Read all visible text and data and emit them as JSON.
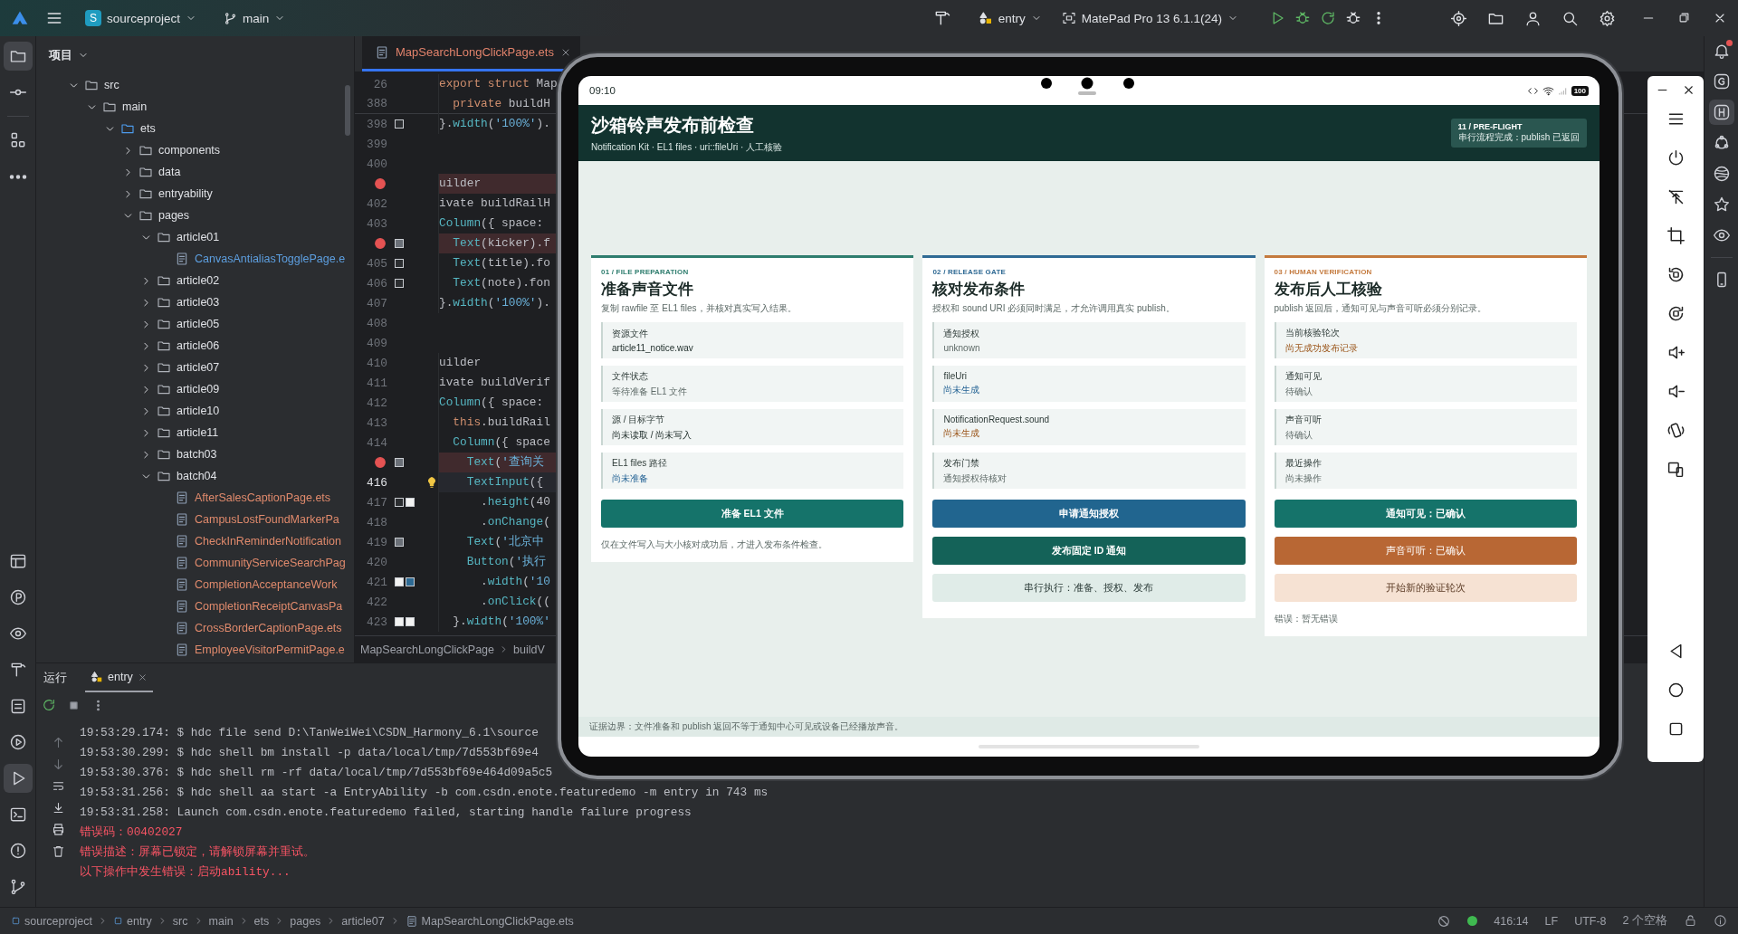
{
  "top_bar": {
    "project_badge": "S",
    "project": "sourceproject",
    "branch": "main",
    "run_config": "entry",
    "device": "MatePad Pro 13 6.1.1(24)"
  },
  "activity_bar": {
    "items": [
      {
        "selected": true
      },
      {
        "selected": false
      },
      {
        "selected": false
      },
      {
        "selected": false
      },
      {
        "selected": false
      },
      {
        "selected": false
      },
      {
        "selected": false
      },
      {
        "selected": false
      },
      {
        "selected": false
      },
      {
        "selected": false
      },
      {
        "selected": true
      },
      {
        "selected": false
      },
      {
        "selected": false
      },
      {
        "selected": false
      }
    ]
  },
  "project_panel": {
    "title": "项目",
    "tree": [
      {
        "name": "src",
        "kind": "folder",
        "expanded": true,
        "children": [
          {
            "name": "main",
            "kind": "folder",
            "expanded": true,
            "children": [
              {
                "name": "ets",
                "kind": "source-folder",
                "expanded": true,
                "children": [
                  {
                    "name": "components",
                    "kind": "folder",
                    "expanded": false
                  },
                  {
                    "name": "data",
                    "kind": "folder",
                    "expanded": false
                  },
                  {
                    "name": "entryability",
                    "kind": "folder",
                    "expanded": false
                  },
                  {
                    "name": "pages",
                    "kind": "folder",
                    "expanded": true,
                    "children": [
                      {
                        "name": "article01",
                        "kind": "folder",
                        "expanded": true,
                        "children": [
                          {
                            "name": "CanvasAntialiasTogglePage.e",
                            "kind": "file",
                            "color": "#5d9fe0"
                          }
                        ]
                      },
                      {
                        "name": "article02",
                        "kind": "folder",
                        "expanded": false
                      },
                      {
                        "name": "article03",
                        "kind": "folder",
                        "expanded": false
                      },
                      {
                        "name": "article05",
                        "kind": "folder",
                        "expanded": false
                      },
                      {
                        "name": "article06",
                        "kind": "folder",
                        "expanded": false
                      },
                      {
                        "name": "article07",
                        "kind": "folder",
                        "expanded": false
                      },
                      {
                        "name": "article09",
                        "kind": "folder",
                        "expanded": false
                      },
                      {
                        "name": "article10",
                        "kind": "folder",
                        "expanded": false
                      },
                      {
                        "name": "article11",
                        "kind": "folder",
                        "expanded": false
                      },
                      {
                        "name": "batch03",
                        "kind": "folder",
                        "expanded": false
                      },
                      {
                        "name": "batch04",
                        "kind": "folder",
                        "expanded": true,
                        "children": [
                          {
                            "name": "AfterSalesCaptionPage.ets",
                            "kind": "file",
                            "color": "#e08a6c"
                          },
                          {
                            "name": "CampusLostFoundMarkerPa",
                            "kind": "file",
                            "color": "#e08a6c"
                          },
                          {
                            "name": "CheckInReminderNotification",
                            "kind": "file",
                            "color": "#e08a6c"
                          },
                          {
                            "name": "CommunityServiceSearchPag",
                            "kind": "file",
                            "color": "#e08a6c"
                          },
                          {
                            "name": "CompletionAcceptanceWork",
                            "kind": "file",
                            "color": "#e08a6c"
                          },
                          {
                            "name": "CompletionReceiptCanvasPa",
                            "kind": "file",
                            "color": "#e08a6c"
                          },
                          {
                            "name": "CrossBorderCaptionPage.ets",
                            "kind": "file",
                            "color": "#e08a6c"
                          },
                          {
                            "name": "EmployeeVisitorPermitPage.e",
                            "kind": "file",
                            "color": "#e08a6c"
                          }
                        ]
                      }
                    ]
                  }
                ]
              }
            ]
          }
        ]
      }
    ]
  },
  "editor": {
    "tab": "MapSearchLongClickPage.ets",
    "lines": [
      {
        "number": "26",
        "text": "export struct Map",
        "kind": "sticky",
        "breakpoint": false,
        "current": false,
        "bulb": false
      },
      {
        "number": "388",
        "text": "  private buildH",
        "kind": "sticky",
        "breakpoint": false,
        "current": false,
        "bulb": false
      },
      {
        "number": "398",
        "text": "}.width('100%').",
        "kind": "code",
        "breakpoint": false,
        "current": false,
        "bulb": false,
        "markers": [
          {
            "kind": "outline"
          }
        ]
      },
      {
        "number": "399",
        "kind": "code",
        "breakpoint": false,
        "current": false,
        "bulb": false
      },
      {
        "number": "400",
        "kind": "code",
        "breakpoint": false,
        "current": false,
        "bulb": false
      },
      {
        "text": "uilder",
        "kind": "code",
        "breakpoint": true,
        "current": false,
        "bulb": false
      },
      {
        "number": "402",
        "text": "ivate buildRailH",
        "kind": "code",
        "breakpoint": false,
        "current": false,
        "bulb": false
      },
      {
        "number": "403",
        "text": "Column({ space:",
        "kind": "code",
        "breakpoint": false,
        "current": false,
        "bulb": false
      },
      {
        "text": "  Text(kicker).f",
        "kind": "code",
        "breakpoint": true,
        "current": false,
        "bulb": false,
        "markers": [
          {
            "kind": "filled"
          }
        ]
      },
      {
        "number": "405",
        "text": "  Text(title).fo",
        "kind": "code",
        "breakpoint": false,
        "current": false,
        "bulb": false,
        "markers": [
          {
            "kind": "outline"
          }
        ]
      },
      {
        "number": "406",
        "text": "  Text(note).fon",
        "kind": "code",
        "breakpoint": false,
        "current": false,
        "bulb": false,
        "markers": [
          {
            "kind": "outline"
          }
        ]
      },
      {
        "number": "407",
        "text": "}.width('100%').",
        "kind": "code",
        "breakpoint": false,
        "current": false,
        "bulb": false
      },
      {
        "number": "408",
        "kind": "code",
        "breakpoint": false,
        "current": false,
        "bulb": false
      },
      {
        "number": "409",
        "kind": "code",
        "breakpoint": false,
        "current": false,
        "bulb": false
      },
      {
        "number": "410",
        "text": "uilder",
        "kind": "code",
        "breakpoint": false,
        "current": false,
        "bulb": false
      },
      {
        "number": "411",
        "text": "ivate buildVerif",
        "kind": "code",
        "breakpoint": false,
        "current": false,
        "bulb": false
      },
      {
        "number": "412",
        "text": "Column({ space:",
        "kind": "code",
        "breakpoint": false,
        "current": false,
        "bulb": false
      },
      {
        "number": "413",
        "text": "  this.buildRail",
        "kind": "code",
        "breakpoint": false,
        "current": false,
        "bulb": false
      },
      {
        "number": "414",
        "text": "  Column({ space",
        "kind": "code",
        "breakpoint": false,
        "current": false,
        "bulb": false
      },
      {
        "text": "    Text('查询关",
        "kind": "code",
        "breakpoint": true,
        "current": false,
        "bulb": false,
        "markers": [
          {
            "kind": "filled"
          }
        ]
      },
      {
        "number": "416",
        "text": "    TextInput({",
        "kind": "code",
        "breakpoint": false,
        "current": true,
        "bulb": true
      },
      {
        "number": "417",
        "text": "      .height(40",
        "kind": "code",
        "breakpoint": false,
        "current": false,
        "bulb": false,
        "markers": [
          {
            "kind": "outline"
          },
          {
            "kind": "light"
          }
        ]
      },
      {
        "number": "418",
        "text": "      .onChange(",
        "kind": "code",
        "breakpoint": false,
        "current": false,
        "bulb": false
      },
      {
        "number": "419",
        "text": "    Text('北京中",
        "kind": "code",
        "breakpoint": false,
        "current": false,
        "bulb": false,
        "markers": [
          {
            "kind": "filled"
          }
        ]
      },
      {
        "number": "420",
        "text": "    Button('执行",
        "kind": "code",
        "breakpoint": false,
        "current": false,
        "bulb": false
      },
      {
        "number": "421",
        "text": "      .width('10",
        "kind": "code",
        "breakpoint": false,
        "current": false,
        "bulb": false,
        "markers": [
          {
            "kind": "light"
          },
          {
            "kind": "accent"
          }
        ]
      },
      {
        "number": "422",
        "text": "      .onClick((",
        "kind": "code",
        "breakpoint": false,
        "current": false,
        "bulb": false
      },
      {
        "number": "423",
        "text": "  }.width('100%'",
        "kind": "code",
        "breakpoint": false,
        "current": false,
        "bulb": false,
        "markers": [
          {
            "kind": "light"
          },
          {
            "kind": "light"
          }
        ]
      }
    ],
    "breadcrumb": [
      "MapSearchLongClickPage",
      "buildV"
    ]
  },
  "run_panel": {
    "title": "运行",
    "tab": "entry",
    "lines": [
      {
        "text": "19:53:29.174: $ hdc file send D:\\TanWeiWei\\CSDN_Harmony_6.1\\source",
        "kind": "log"
      },
      {
        "text": "19:53:30.299: $ hdc shell bm install -p data/local/tmp/7d553bf69e4",
        "kind": "log"
      },
      {
        "text": "19:53:30.376: $ hdc shell rm -rf data/local/tmp/7d553bf69e464d09a5c5",
        "kind": "log"
      },
      {
        "text": "19:53:31.256: $ hdc shell aa start -a EntryAbility -b com.csdn.enote.featuredemo -m entry in 743 ms",
        "kind": "log"
      },
      {
        "text": "19:53:31.258: Launch com.csdn.enote.featuredemo failed, starting handle failure progress",
        "kind": "log"
      },
      {
        "text": "错误码：00402027",
        "kind": "error"
      },
      {
        "text": "错误描述：屏幕已锁定，请解锁屏幕并重试。",
        "kind": "error"
      },
      {
        "text": "以下操作中发生错误：启动ability...",
        "kind": "error"
      }
    ]
  },
  "status_bar": {
    "path": [
      {
        "text": "sourceproject",
        "kind": "module"
      },
      {
        "text": "entry",
        "kind": "module"
      },
      {
        "text": "src",
        "kind": "folder"
      },
      {
        "text": "main",
        "kind": "folder"
      },
      {
        "text": "ets",
        "kind": "folder"
      },
      {
        "text": "pages",
        "kind": "folder"
      },
      {
        "text": "article07",
        "kind": "folder"
      },
      {
        "text": "MapSearchLongClickPage.ets",
        "kind": "file"
      }
    ],
    "position": "416:14",
    "line_ending": "LF",
    "encoding": "UTF-8",
    "indent": "2 个空格"
  },
  "emulator": {
    "time": "09:10",
    "battery": "100",
    "app": {
      "title": "沙箱铃声发布前检查",
      "subtitle": "Notification Kit · EL1 files · uri::fileUri · 人工核验",
      "badge": {
        "step": "11 / PRE-FLIGHT",
        "status": "串行流程完成：publish 已返回"
      },
      "cards": [
        {
          "kicker": "01 / FILE PREPARATION",
          "title": "准备声音文件",
          "desc": "复制 rawfile 至 EL1 files，并核对真实写入结果。",
          "color": "#2e7d6e",
          "fields": [
            {
              "label": "资源文件",
              "value": "article11_notice.wav",
              "kind": "plain"
            },
            {
              "label": "文件状态",
              "value": "等待准备 EL1 文件",
              "kind": "muted"
            },
            {
              "label": "源 / 目标字节",
              "value": "尚未读取 / 尚未写入",
              "kind": "plain"
            },
            {
              "label": "EL1 files 路径",
              "value": "尚未准备",
              "kind": "info"
            }
          ],
          "actions": [
            {
              "label": "准备 EL1 文件",
              "kind": "primary"
            }
          ],
          "note": "仅在文件写入与大小核对成功后，才进入发布条件检查。"
        },
        {
          "kicker": "02 / RELEASE GATE",
          "title": "核对发布条件",
          "desc": "授权和 sound URI 必须同时满足，才允许调用真实 publish。",
          "color": "#2f6a94",
          "fields": [
            {
              "label": "通知授权",
              "value": "unknown",
              "kind": "muted"
            },
            {
              "label": "fileUri",
              "value": "尚未生成",
              "kind": "info"
            },
            {
              "label": "NotificationRequest.sound",
              "value": "尚未生成",
              "kind": "warning"
            },
            {
              "label": "发布门禁",
              "value": "通知授权待核对",
              "kind": "muted"
            }
          ],
          "actions": [
            {
              "label": "申请通知授权",
              "kind": "accent"
            },
            {
              "label": "发布固定 ID 通知",
              "kind": "strong"
            },
            {
              "label": "串行执行：准备、授权、发布",
              "kind": "secondary"
            }
          ]
        },
        {
          "kicker": "03 / HUMAN VERIFICATION",
          "title": "发布后人工核验",
          "desc": "publish 返回后，通知可见与声音可听必须分别记录。",
          "color": "#c47a3e",
          "fields": [
            {
              "label": "当前核验轮次",
              "value": "尚无成功发布记录",
              "kind": "warning"
            },
            {
              "label": "通知可见",
              "value": "待确认",
              "kind": "muted"
            },
            {
              "label": "声音可听",
              "value": "待确认",
              "kind": "muted"
            },
            {
              "label": "最近操作",
              "value": "尚未操作",
              "kind": "muted"
            }
          ],
          "actions": [
            {
              "label": "通知可见：已确认",
              "kind": "primary"
            },
            {
              "label": "声音可听：已确认",
              "kind": "warning"
            },
            {
              "label": "开始新的验证轮次",
              "kind": "soft"
            }
          ],
          "note": "错误：暂无错误"
        }
      ],
      "footer": "证据边界：文件准备和 publish 返回不等于通知中心可见或设备已经播放声音。"
    }
  }
}
